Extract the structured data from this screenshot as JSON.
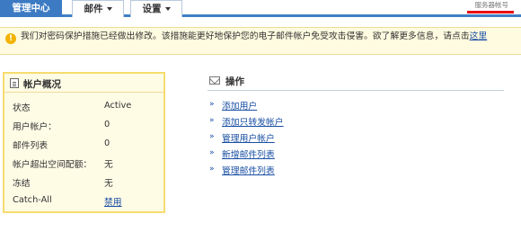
{
  "nav": {
    "tabs": [
      {
        "label": "管理中心",
        "active": true
      },
      {
        "label": "邮件",
        "has_dropdown": true
      },
      {
        "label": "设置",
        "has_dropdown": true
      }
    ],
    "top_right_text": "服务器帐号"
  },
  "notice": {
    "icon": "info-icon",
    "text": "我们对密码保护措施已经做出修改。该措施能更好地保护您的电子邮件帐户免受攻击侵害。欲了解更多信息，请点击",
    "link_text": "这里"
  },
  "account": {
    "title": "帐户概况",
    "icon": "document-icon",
    "rows": [
      {
        "label": "状态",
        "value": "Active"
      },
      {
        "label": "用户帐户：",
        "value": "0"
      },
      {
        "label": "邮件列表",
        "value": "0"
      },
      {
        "label": "帐户超出空间配额：",
        "value": "无"
      },
      {
        "label": "冻结",
        "value": "无"
      },
      {
        "label": "Catch-All",
        "value": "禁用",
        "is_link": true
      }
    ]
  },
  "operations": {
    "title": "操作",
    "icon": "envelope-icon",
    "items": [
      {
        "label": "添加用户"
      },
      {
        "label": "添加只转发帐户"
      },
      {
        "label": "管理用户帐户"
      },
      {
        "label": "新增邮件列表"
      },
      {
        "label": "管理邮件列表"
      }
    ]
  },
  "colors": {
    "nav_active": "#3c7bc3",
    "link": "#1a4fa3",
    "notice_bg": "#fffbe0",
    "panel_border": "#f6dc6e"
  }
}
